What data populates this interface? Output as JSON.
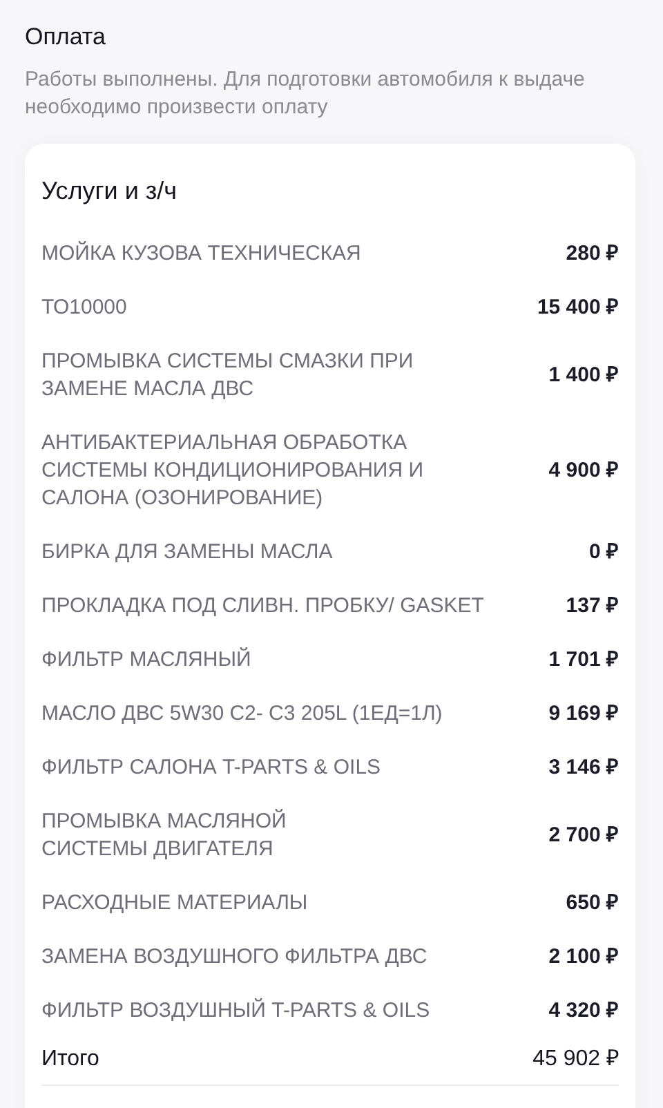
{
  "section": {
    "title": "Оплата",
    "description": "Работы выполнены. Для подготовки автомобиля к выдаче необходимо произвести оплату"
  },
  "card": {
    "title": "Услуги и з/ч",
    "items": [
      {
        "name": "МОЙКА КУЗОВА ТЕХНИЧЕСКАЯ",
        "price": "280 ₽"
      },
      {
        "name": "ТО10000",
        "price": "15 400 ₽"
      },
      {
        "name": "ПРОМЫВКА СИСТЕМЫ СМАЗКИ ПРИ\nЗАМЕНЕ МАСЛА ДВС",
        "price": "1 400 ₽"
      },
      {
        "name": "АНТИБАКТЕРИАЛЬНАЯ ОБРАБОТКА\nСИСТЕМЫ КОНДИЦИОНИРОВАНИЯ И\nСАЛОНА (ОЗОНИРОВАНИЕ)",
        "price": "4 900 ₽"
      },
      {
        "name": "БИРКА ДЛЯ ЗАМЕНЫ МАСЛА",
        "price": "0 ₽"
      },
      {
        "name": "ПРОКЛАДКА ПОД СЛИВН. ПРОБКУ/ GASKET",
        "price": "137 ₽"
      },
      {
        "name": "ФИЛЬТР МАСЛЯНЫЙ",
        "price": "1 701 ₽"
      },
      {
        "name": "МАСЛО ДВС 5W30 C2- C3 205L (1ЕД=1Л)",
        "price": "9 169 ₽"
      },
      {
        "name": "ФИЛЬТР САЛОНА T-PARTS & OILS",
        "price": "3 146 ₽"
      },
      {
        "name": "ПРОМЫВКА МАСЛЯНОЙ\nСИСТЕМЫ ДВИГАТЕЛЯ",
        "price": "2 700 ₽"
      },
      {
        "name": "РАСХОДНЫЕ МАТЕРИАЛЫ",
        "price": "650 ₽"
      },
      {
        "name": "ЗАМЕНА ВОЗДУШНОГО ФИЛЬТРА ДВС",
        "price": "2 100 ₽"
      },
      {
        "name": "ФИЛЬТР ВОЗДУШНЫЙ T-PARTS & OILS",
        "price": "4 320 ₽"
      }
    ],
    "total": {
      "label": "Итого",
      "value": "45 902 ₽"
    }
  }
}
